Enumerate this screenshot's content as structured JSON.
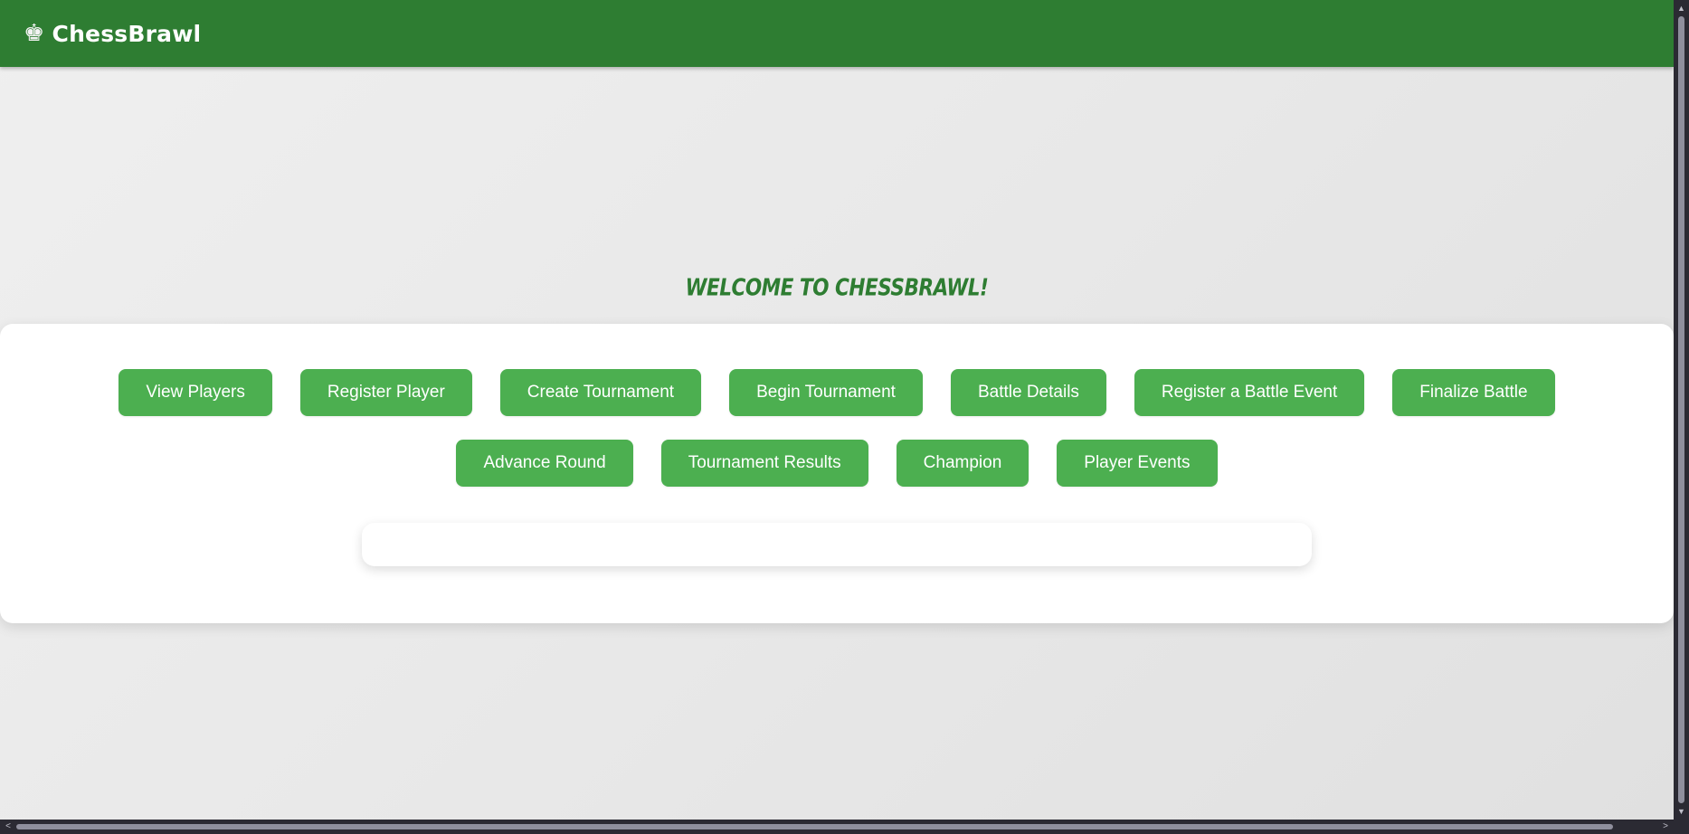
{
  "navbar": {
    "brand_icon": "♚",
    "brand_icon_name": "chess-king-icon",
    "brand_text": "ChessBrawl",
    "background": "#2e7d32"
  },
  "main": {
    "welcome_title": "Welcome to ChessBrawl!",
    "title_color": "#2e7d32"
  },
  "actions": {
    "row1": [
      {
        "label": "View Players"
      },
      {
        "label": "Register Player"
      },
      {
        "label": "Create Tournament"
      },
      {
        "label": "Begin Tournament"
      },
      {
        "label": "Battle Details"
      },
      {
        "label": "Register a Battle Event"
      },
      {
        "label": "Finalize Battle"
      }
    ],
    "row2": [
      {
        "label": "Advance Round"
      },
      {
        "label": "Tournament Results"
      },
      {
        "label": "Champion"
      },
      {
        "label": "Player Events"
      }
    ],
    "button_color": "#4caf50"
  },
  "scrollbars": {
    "up_arrow": "▲",
    "down_arrow": "▼",
    "left_arrow": "<",
    "right_arrow": ">"
  }
}
